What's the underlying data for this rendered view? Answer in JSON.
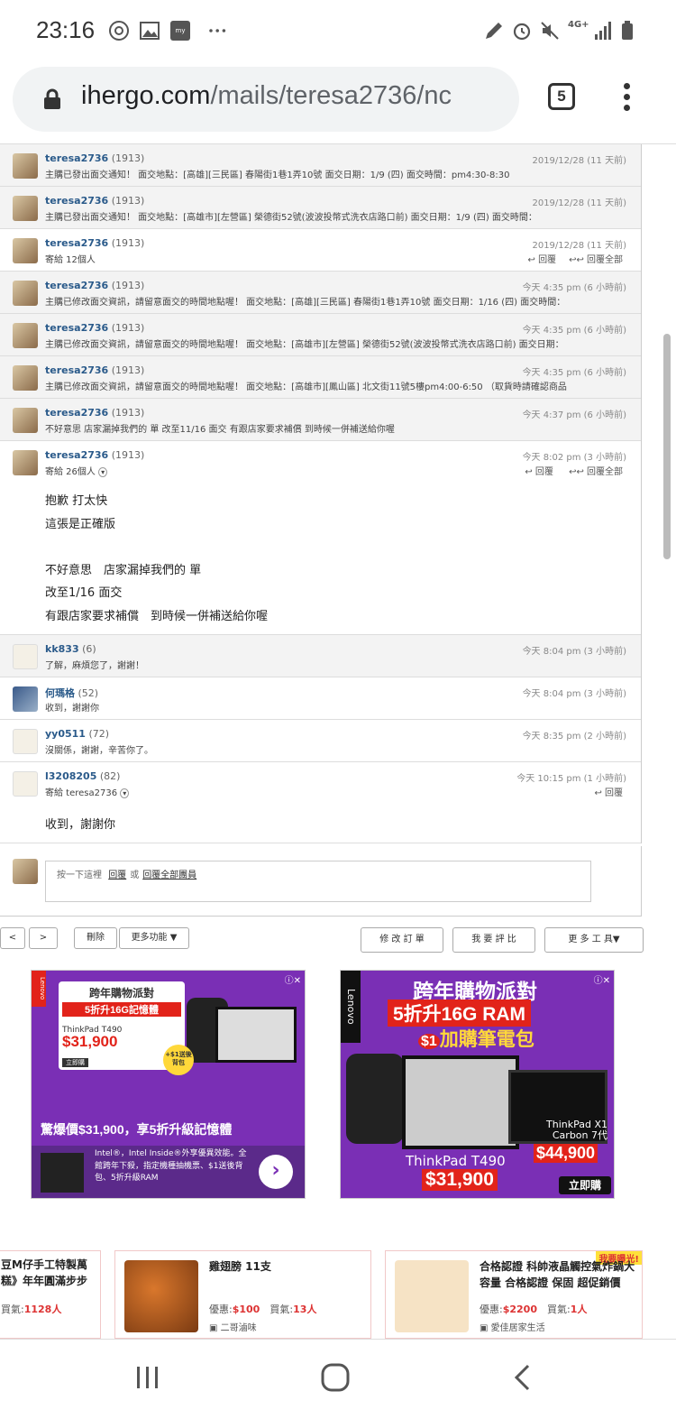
{
  "status_bar": {
    "time": "23:16",
    "network": "4G+"
  },
  "browser": {
    "url_host": "ihergo.com",
    "url_path": "/mails/teresa2736/nc",
    "tab_count": "5"
  },
  "messages": [
    {
      "sender": "teresa2736",
      "score": "(1913)",
      "date": "2019/12/28 (11 天前)",
      "snippet": "主購已發出面交通知！ 面交地點：[高雄][三民區] 春陽街1巷1弄10號 面交日期：1/9 (四) 面交時間：pm4:30-8:30"
    },
    {
      "sender": "teresa2736",
      "score": "(1913)",
      "date": "2019/12/28 (11 天前)",
      "snippet": "主購已發出面交通知！ 面交地點：[高雄市][左營區] 榮德街52號(波波投幣式洗衣店路口前) 面交日期：1/9 (四) 面交時間："
    },
    {
      "sender": "teresa2736",
      "score": "(1913)",
      "date": "2019/12/28 (11 天前)",
      "snippet": "寄給 12個人",
      "reply": "回覆",
      "reply_all": "回覆全部"
    },
    {
      "sender": "teresa2736",
      "score": "(1913)",
      "date": "今天 4:35 pm (6 小時前)",
      "snippet": "主購已修改面交資訊，請留意面交的時間地點喔！ 面交地點：[高雄][三民區] 春陽街1巷1弄10號 面交日期：1/16 (四) 面交時間："
    },
    {
      "sender": "teresa2736",
      "score": "(1913)",
      "date": "今天 4:35 pm (6 小時前)",
      "snippet": "主購已修改面交資訊，請留意面交的時間地點喔！ 面交地點：[高雄市][左營區] 榮德街52號(波波投幣式洗衣店路口前) 面交日期："
    },
    {
      "sender": "teresa2736",
      "score": "(1913)",
      "date": "今天 4:35 pm (6 小時前)",
      "snippet": "主購已修改面交資訊，請留意面交的時間地點喔！ 面交地點：[高雄市][鳳山區] 北文街11號5樓pm4:00-6:50 （取貨時請確認商品"
    },
    {
      "sender": "teresa2736",
      "score": "(1913)",
      "date": "今天 4:37 pm (6 小時前)",
      "snippet": "不好意思 店家漏掉我們的 單 改至11/16 面交 有跟店家要求補償 到時候一併補送給你喔"
    }
  ],
  "expanded": {
    "sender": "teresa2736",
    "score": "(1913)",
    "date": "今天 8:02 pm (3 小時前)",
    "to": "寄給 26個人",
    "reply": "回覆",
    "reply_all": "回覆全部",
    "lines": [
      "抱歉 打太快",
      "這張是正確版",
      "",
      "不好意思　店家漏掉我們的 單",
      "改至1/16 面交",
      "有跟店家要求補償　到時候一併補送給你喔"
    ]
  },
  "replies": [
    {
      "sender": "kk833",
      "score": "(6)",
      "date": "今天 8:04 pm (3 小時前)",
      "snippet": "了解，麻煩您了，謝謝！"
    },
    {
      "sender": "何瑪格",
      "score": "(52)",
      "date": "今天 8:04 pm (3 小時前)",
      "snippet": "收到，謝謝你"
    },
    {
      "sender": "yy0511",
      "score": "(72)",
      "date": "今天 8:35 pm (2 小時前)",
      "snippet": "沒關係，謝謝，辛苦你了。"
    }
  ],
  "last": {
    "sender": "l3208205",
    "score": "(82)",
    "date": "今天 10:15 pm (1 小時前)",
    "to": "寄給 teresa2736",
    "reply": "回覆",
    "body": "收到，謝謝你"
  },
  "reply_box": {
    "prompt": "按一下這裡",
    "reply": "回覆",
    "or": "或",
    "reply_all": "回覆全部團員"
  },
  "toolbar": {
    "prev": "<",
    "next": ">",
    "delete": "刪除",
    "more": "更多功能 ▼",
    "edit_order": "修 改 訂 單",
    "rate": "我 要 評 比",
    "tools": "更 多 工 具▼"
  },
  "ad1": {
    "brand": "Lenovo",
    "headline1": "跨年購物派對",
    "headline2": "5折升16G記憶體",
    "model": "ThinkPad T490",
    "price": "$31,900",
    "cta": "立即購",
    "badge": "+$1送後背包",
    "banner": "驚爆價$31,900，享5折升級記憶體",
    "desc": "Intel®，Intel Inside®外享優異效能。全館跨年下殺，指定機種抽機票、$1送後背包、5折升級RAM"
  },
  "ad2": {
    "brand": "Lenovo",
    "headline1": "跨年購物派對",
    "headline2": "5折升16G RAM",
    "headline3_prefix": "$1",
    "headline3": "加購筆電包",
    "model1": "ThinkPad T490",
    "price1": "$31,900",
    "model2": "ThinkPad X1 Carbon 7代",
    "price2": "$44,900",
    "cta": "立即購"
  },
  "shops": [
    {
      "title": "豆M仔手工特製萬糕》年年圓滿步步",
      "buyers_label": "買氣:",
      "buyers": "1128人"
    },
    {
      "title": "雞翅膀 11支",
      "price_label": "優惠:",
      "price": "$100",
      "buyers_label": "買氣:",
      "buyers": "13人",
      "shop": "二哥滷味"
    },
    {
      "title": "合格認證 科帥液晶觸控氣炸鍋大容量 合格認證 保固 超促銷價",
      "price_label": "優惠:",
      "price": "$2200",
      "buyers_label": "買氣:",
      "buyers": "1人",
      "shop": "愛佳居家生活",
      "tag": "我要曝光!"
    }
  ],
  "colors": {
    "link": "#2a5a8a",
    "ad_purple": "#7a2fb5",
    "price_red": "#d33"
  }
}
